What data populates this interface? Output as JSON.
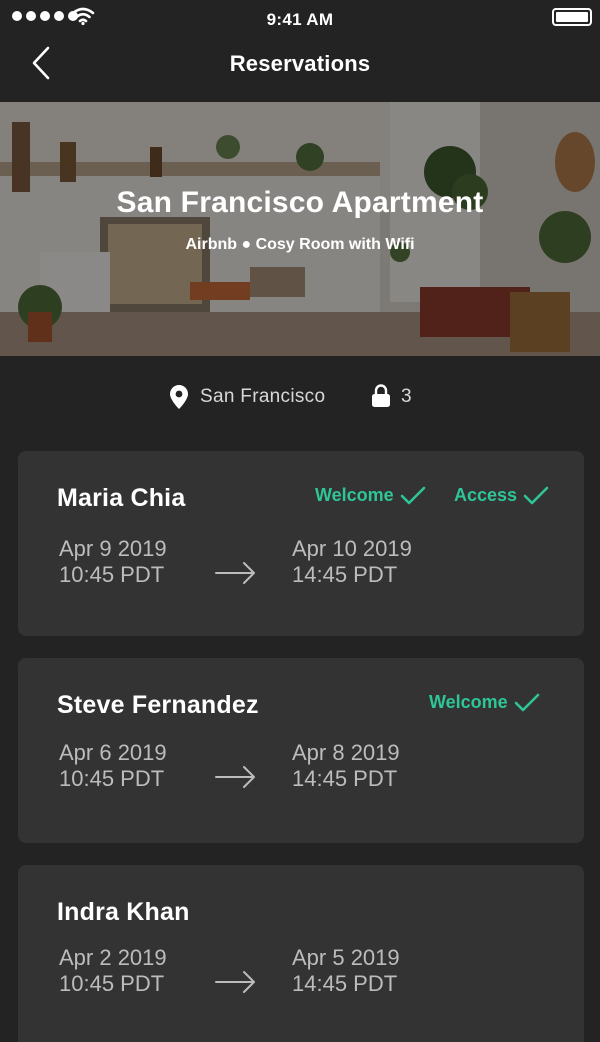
{
  "status_bar": {
    "time": "9:41 AM"
  },
  "nav": {
    "title": "Reservations",
    "back_icon": "chevron-left-icon"
  },
  "hero": {
    "title": "San Francisco Apartment",
    "subtitle": "Airbnb ● Cosy Room with Wifi"
  },
  "info": {
    "location": "San Francisco",
    "location_icon": "map-pin-icon",
    "locks": "3",
    "locks_icon": "lock-icon"
  },
  "colors": {
    "background": "#232323",
    "card": "#333333",
    "accent": "#2ec597",
    "muted_text": "#bcbcbc"
  },
  "reservations": [
    {
      "name": "Maria Chia",
      "badges": [
        "Welcome",
        "Access"
      ],
      "check_in": {
        "date": "Apr 9 2019",
        "time": "10:45 PDT"
      },
      "check_out": {
        "date": "Apr 10 2019",
        "time": "14:45 PDT"
      }
    },
    {
      "name": "Steve Fernandez",
      "badges": [
        "Welcome"
      ],
      "check_in": {
        "date": "Apr 6 2019",
        "time": "10:45 PDT"
      },
      "check_out": {
        "date": "Apr 8 2019",
        "time": "14:45 PDT"
      }
    },
    {
      "name": "Indra Khan",
      "badges": [],
      "check_in": {
        "date": "Apr 2 2019",
        "time": "10:45 PDT"
      },
      "check_out": {
        "date": "Apr 5 2019",
        "time": "14:45 PDT"
      }
    }
  ]
}
